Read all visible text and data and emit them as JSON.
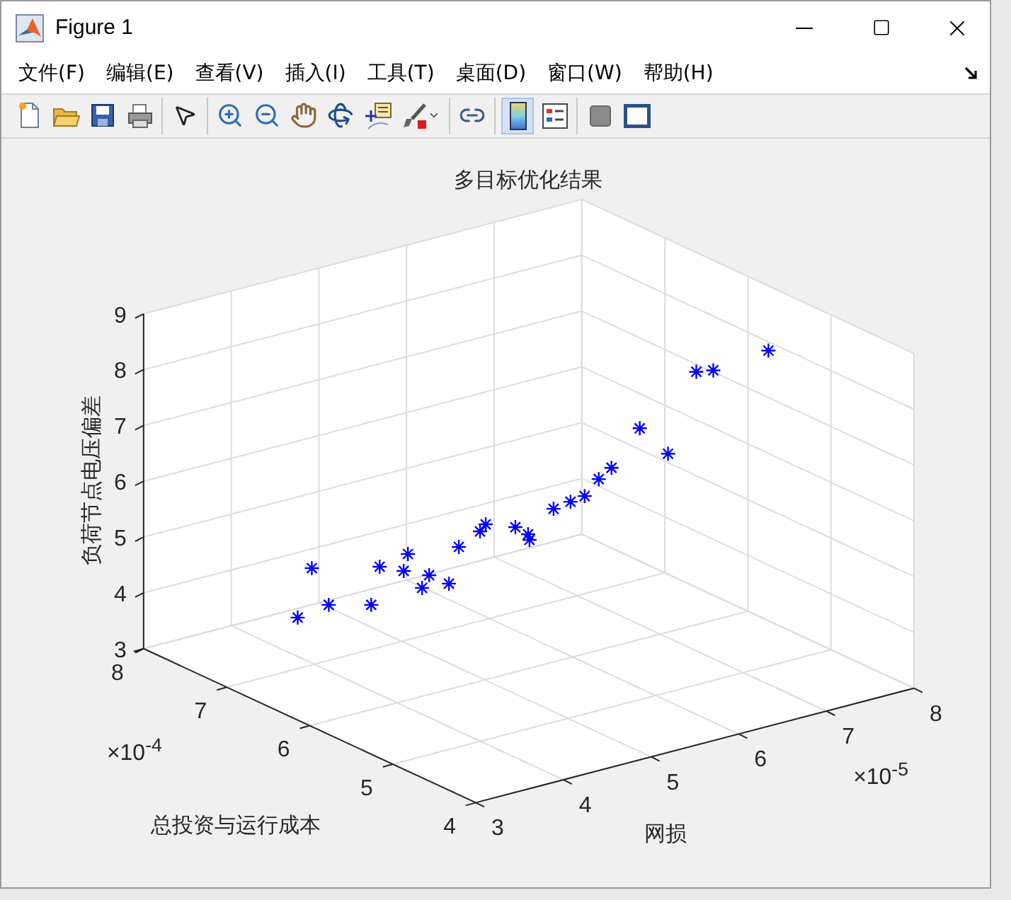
{
  "window": {
    "title": "Figure 1"
  },
  "menu": [
    "文件(F)",
    "编辑(E)",
    "查看(V)",
    "插入(I)",
    "工具(T)",
    "桌面(D)",
    "窗口(W)",
    "帮助(H)"
  ],
  "toolbar": [
    [
      {
        "kind": "new",
        "pressed": false
      },
      {
        "kind": "open",
        "pressed": false
      },
      {
        "kind": "save",
        "pressed": false
      },
      {
        "kind": "print",
        "pressed": false
      }
    ],
    [
      {
        "kind": "pointer",
        "pressed": false
      }
    ],
    [
      {
        "kind": "zoom-in",
        "pressed": false
      },
      {
        "kind": "zoom-out",
        "pressed": false
      },
      {
        "kind": "pan",
        "pressed": false
      },
      {
        "kind": "rotate",
        "pressed": false
      },
      {
        "kind": "datatip",
        "pressed": false
      },
      {
        "kind": "brush",
        "pressed": false
      }
    ],
    [
      {
        "kind": "link",
        "pressed": false
      }
    ],
    [
      {
        "kind": "colorbar",
        "pressed": true
      },
      {
        "kind": "legend",
        "pressed": false
      }
    ],
    [
      {
        "kind": "hide",
        "pressed": false
      },
      {
        "kind": "panel",
        "pressed": false
      }
    ]
  ],
  "plot": {
    "title": "多目标优化结果",
    "zaxis": {
      "label": "负荷节点电压偏差",
      "ticks": [
        "9",
        "8",
        "7",
        "6",
        "5",
        "4",
        "3"
      ]
    },
    "yaxis": {
      "label": "总投资与运行成本",
      "ticks": [
        "4",
        "5",
        "6",
        "7",
        "8"
      ],
      "exponent": "×10$^{-4}$"
    },
    "xaxis": {
      "label": "网损",
      "ticks": [
        "3",
        "4",
        "5",
        "6",
        "7",
        "8"
      ],
      "exponent": "×10$^{-5}$"
    }
  }
}
